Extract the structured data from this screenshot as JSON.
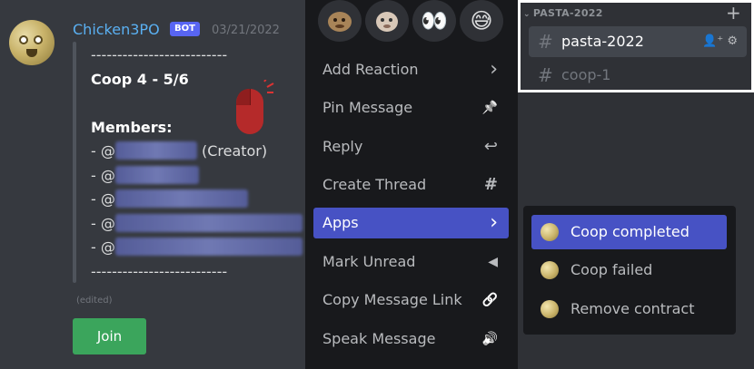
{
  "message": {
    "username": "Chicken3PO",
    "bot_tag": "BOT",
    "timestamp": "03/21/2022",
    "divider": "--------------------------",
    "title": "Coop 4 - 5/6",
    "members_label": "Members:",
    "member_prefix": "- @",
    "creator_suffix": "(Creator)",
    "edited": "(edited)",
    "join_label": "Join"
  },
  "reactions": [
    {
      "icon": "meme-face-1"
    },
    {
      "icon": "meme-face-2"
    },
    {
      "icon": "eyes-emoji",
      "glyph": "👀"
    },
    {
      "icon": "sweat-smile-emoji",
      "glyph": "😅"
    }
  ],
  "context_menu": {
    "items": [
      {
        "label": "Add Reaction",
        "icon": "chevron-right-icon",
        "glyph": "›"
      },
      {
        "label": "Pin Message",
        "icon": "pin-icon",
        "glyph": "📌"
      },
      {
        "label": "Reply",
        "icon": "reply-icon",
        "glyph": "↩"
      },
      {
        "label": "Create Thread",
        "icon": "thread-icon",
        "glyph": "#"
      },
      {
        "label": "Apps",
        "icon": "chevron-right-icon",
        "glyph": "›"
      },
      {
        "label": "Mark Unread",
        "icon": "mark-unread-icon",
        "glyph": "◀"
      },
      {
        "label": "Copy Message Link",
        "icon": "link-icon",
        "glyph": "🔗"
      },
      {
        "label": "Speak Message",
        "icon": "speak-icon",
        "glyph": "🔊"
      }
    ]
  },
  "channels": {
    "category": "PASTA-2022",
    "items": [
      {
        "name": "pasta-2022"
      },
      {
        "name": "coop-1"
      }
    ]
  },
  "apps_submenu": {
    "items": [
      {
        "label": "Coop completed"
      },
      {
        "label": "Coop failed"
      },
      {
        "label": "Remove contract"
      }
    ]
  },
  "colors": {
    "accent": "#5865f2",
    "join_green": "#3ba55c",
    "username": "#5ab0f2"
  }
}
